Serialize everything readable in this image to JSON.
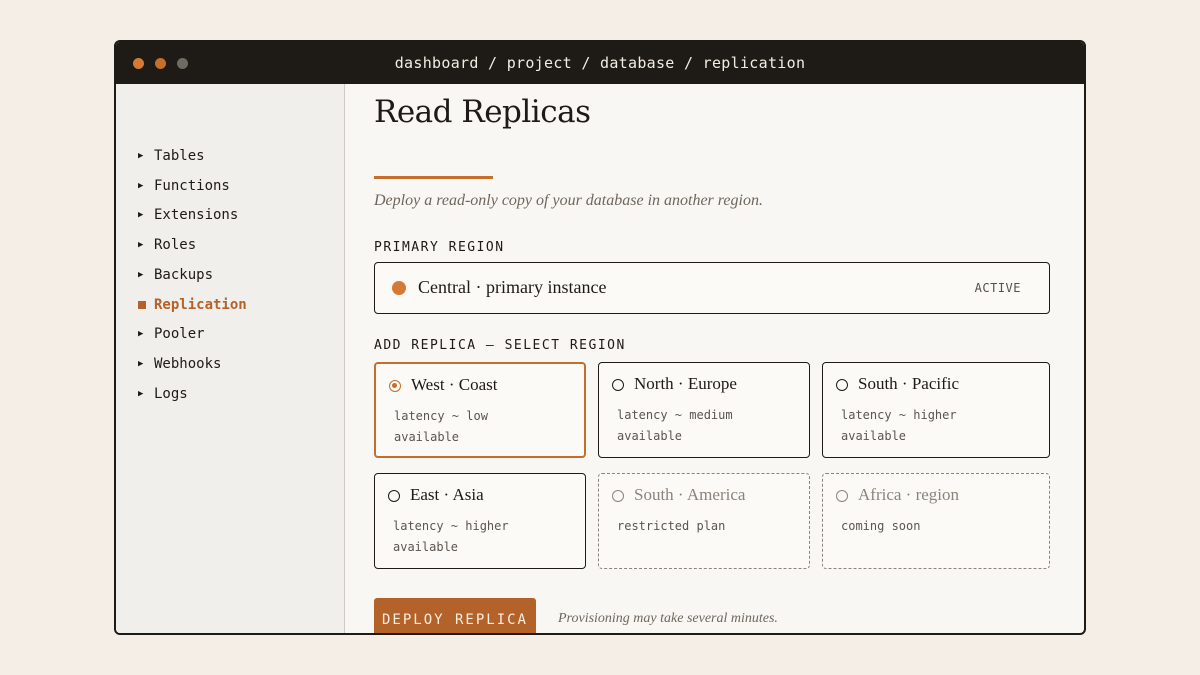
{
  "window": {
    "breadcrumb": "dashboard / project / database / replication"
  },
  "sidebar": {
    "items": [
      {
        "label": "Tables",
        "active": false
      },
      {
        "label": "Functions",
        "active": false
      },
      {
        "label": "Extensions",
        "active": false
      },
      {
        "label": "Roles",
        "active": false
      },
      {
        "label": "Backups",
        "active": false
      },
      {
        "label": "Replication",
        "active": true
      },
      {
        "label": "Pooler",
        "active": false
      },
      {
        "label": "Webhooks",
        "active": false
      },
      {
        "label": "Logs",
        "active": false
      }
    ]
  },
  "main": {
    "title": "Read Replicas",
    "subtitle": "Deploy a read-only copy of your database in another region.",
    "primary": {
      "label": "PRIMARY REGION",
      "name": "Central · primary instance",
      "status": "ACTIVE"
    },
    "add": {
      "label": "ADD REPLICA — SELECT REGION",
      "regions": [
        {
          "name": "West · Coast",
          "line1": "latency ~ low",
          "line2": "available",
          "state": "selected"
        },
        {
          "name": "North · Europe",
          "line1": "latency ~ medium",
          "line2": "available",
          "state": "available"
        },
        {
          "name": "South · Pacific",
          "line1": "latency ~ higher",
          "line2": "available",
          "state": "available"
        },
        {
          "name": "East · Asia",
          "line1": "latency ~ higher",
          "line2": "available",
          "state": "available"
        },
        {
          "name": "South · America",
          "line1": "restricted plan",
          "line2": "",
          "state": "disabled"
        },
        {
          "name": "Africa · region",
          "line1": "coming soon",
          "line2": "",
          "state": "disabled"
        }
      ]
    },
    "deploy": {
      "button": "DEPLOY REPLICA",
      "note": "Provisioning may take several minutes."
    }
  },
  "colors": {
    "accent": "#b3622a",
    "background": "#f5eee6",
    "ink": "#1e1a16"
  }
}
